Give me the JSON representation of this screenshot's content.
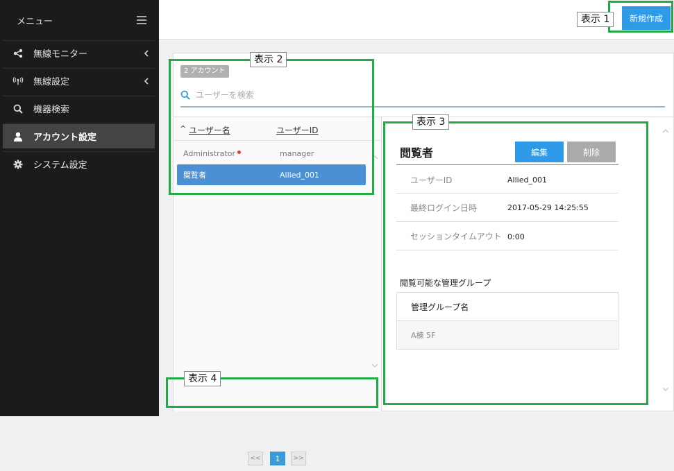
{
  "sidebar": {
    "menu_title": "メニュー",
    "items": [
      {
        "label": "無線モニター",
        "icon": "share-icon",
        "chevron": true
      },
      {
        "label": "無線設定",
        "icon": "wireless-icon",
        "chevron": true
      },
      {
        "label": "機器検索",
        "icon": "search-icon",
        "chevron": false
      },
      {
        "label": "アカウント設定",
        "icon": "user-icon",
        "chevron": false,
        "active": true
      },
      {
        "label": "システム設定",
        "icon": "gear-icon",
        "chevron": false
      }
    ]
  },
  "topbar": {
    "new_button": "新規作成"
  },
  "list": {
    "count_badge": "2 アカウント",
    "search_placeholder": "ユーザーを検索",
    "col_name": "ユーザー名",
    "col_id": "ユーザーID",
    "sort_indicator": "^",
    "rows": [
      {
        "name": "Administrator",
        "id": "manager",
        "required": true
      },
      {
        "name": "閲覧者",
        "id": "Allied_001",
        "selected": true
      }
    ]
  },
  "pagination": {
    "prev": "<<",
    "current": "1",
    "next": ">>"
  },
  "detail": {
    "title": "閲覧者",
    "edit_button": "編集",
    "delete_button": "削除",
    "fields": [
      {
        "label": "ユーザーID",
        "value": "Allied_001"
      },
      {
        "label": "最終ログイン日時",
        "value": "2017-05-29 14:25:55"
      },
      {
        "label": "セッションタイムアウト",
        "value": "0:00"
      }
    ],
    "group_heading": "閲覧可能な管理グループ",
    "group_col": "管理グループ名",
    "groups": [
      "A棟 5F"
    ]
  },
  "annotations": {
    "label_1": "表示 1",
    "label_2": "表示 2",
    "label_3": "表示 3",
    "label_4": "表示 4"
  },
  "colors": {
    "accent": "#2f9be8",
    "sidebar_bg": "#1b1b1b",
    "selected_row": "#4b8fd4",
    "annotation_green": "#22aa44"
  }
}
